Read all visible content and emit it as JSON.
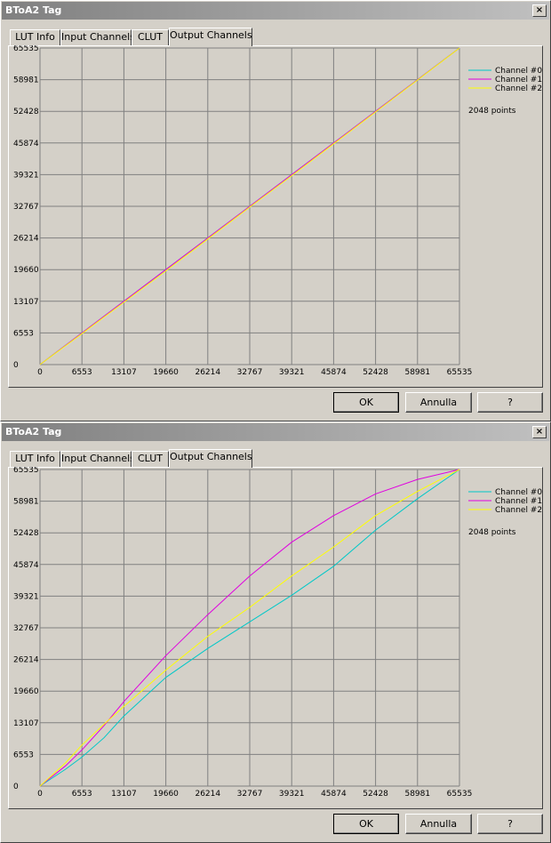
{
  "dialogs": [
    {
      "title": "BToA2 Tag",
      "close_label": "×",
      "tabs": [
        "LUT Info",
        "Input Channels",
        "CLUT",
        "Output Channels"
      ],
      "active_tab": 3,
      "buttons": {
        "ok": "OK",
        "cancel": "Annulla",
        "help": "?"
      },
      "points_label": "2048 points",
      "chart_data": {
        "type": "line",
        "xlim": [
          0,
          65535
        ],
        "ylim": [
          0,
          65535
        ],
        "x_ticks": [
          "0",
          "6553",
          "13107",
          "19660",
          "26214",
          "32767",
          "39321",
          "45874",
          "52428",
          "58981",
          "65535"
        ],
        "y_ticks": [
          "0",
          "6553",
          "13107",
          "19660",
          "26214",
          "32767",
          "39321",
          "45874",
          "52428",
          "58981",
          "65535"
        ],
        "grid": true,
        "legend_position": "right",
        "x": [
          0,
          6553,
          13107,
          19660,
          26214,
          32767,
          39321,
          45874,
          52428,
          58981,
          65535
        ],
        "series": [
          {
            "name": "Channel #0",
            "color": "#00c8c8",
            "values": [
              0,
              6553,
              13107,
              19660,
              26214,
              32767,
              39321,
              45874,
              52428,
              58981,
              65535
            ]
          },
          {
            "name": "Channel #1",
            "color": "#e000e0",
            "values": [
              0,
              6553,
              13107,
              19660,
              26214,
              32767,
              39321,
              45874,
              52428,
              58981,
              65535
            ]
          },
          {
            "name": "Channel #2",
            "color": "#ffff00",
            "values": [
              0,
              6400,
              12900,
              19400,
              26000,
              32600,
              39100,
              45700,
              52300,
              58900,
              65535
            ]
          }
        ]
      }
    },
    {
      "title": "BToA2 Tag",
      "close_label": "×",
      "tabs": [
        "LUT Info",
        "Input Channels",
        "CLUT",
        "Output Channels"
      ],
      "active_tab": 3,
      "buttons": {
        "ok": "OK",
        "cancel": "Annulla",
        "help": "?"
      },
      "points_label": "2048 points",
      "chart_data": {
        "type": "line",
        "xlim": [
          0,
          65535
        ],
        "ylim": [
          0,
          65535
        ],
        "x_ticks": [
          "0",
          "6553",
          "13107",
          "19660",
          "26214",
          "32767",
          "39321",
          "45874",
          "52428",
          "58981",
          "65535"
        ],
        "y_ticks": [
          "0",
          "6553",
          "13107",
          "19660",
          "26214",
          "32767",
          "39321",
          "45874",
          "52428",
          "58981",
          "65535"
        ],
        "grid": true,
        "legend_position": "right",
        "x": [
          0,
          4000,
          6553,
          10000,
          13107,
          19660,
          26214,
          32767,
          39321,
          45874,
          52428,
          58981,
          65535
        ],
        "series": [
          {
            "name": "Channel #0",
            "color": "#00c8c8",
            "values": [
              0,
              3500,
              6000,
              10000,
              14500,
              22500,
              28500,
              34000,
              39500,
              45500,
              53000,
              59500,
              65535
            ]
          },
          {
            "name": "Channel #1",
            "color": "#e000e0",
            "values": [
              0,
              4200,
              7500,
              12500,
              17500,
              27000,
              35500,
              43500,
              50500,
              56000,
              60500,
              63500,
              65535
            ]
          },
          {
            "name": "Channel #2",
            "color": "#ffff00",
            "values": [
              0,
              4800,
              8500,
              12800,
              16500,
              24000,
              31000,
              37000,
              43500,
              49500,
              56000,
              61000,
              65535
            ]
          }
        ]
      }
    }
  ]
}
